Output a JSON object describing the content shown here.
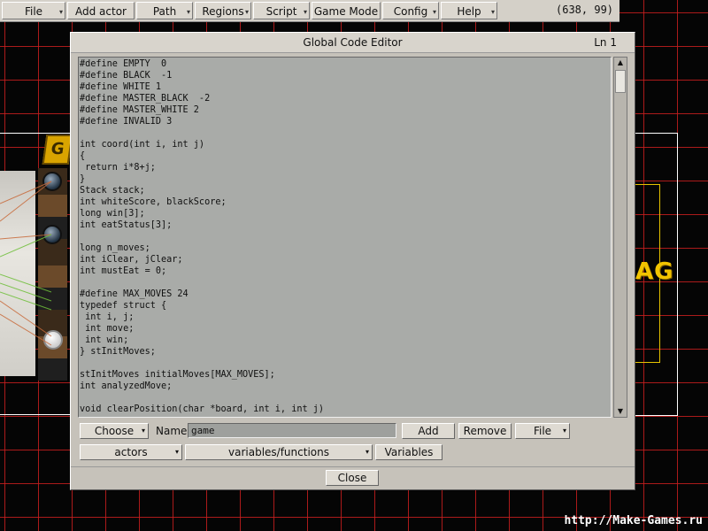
{
  "menu": {
    "items": [
      {
        "label": "File",
        "dropdown": true
      },
      {
        "label": "Add actor",
        "dropdown": false
      },
      {
        "label": "Path",
        "dropdown": true
      },
      {
        "label": "Regions",
        "dropdown": true
      },
      {
        "label": "Script",
        "dropdown": true
      },
      {
        "label": "Game Mode",
        "dropdown": false
      },
      {
        "label": "Config",
        "dropdown": true
      },
      {
        "label": "Help",
        "dropdown": true
      }
    ],
    "coords": "(638, 99)"
  },
  "editor": {
    "title": "Global Code Editor",
    "line_indicator": "Ln 1",
    "code_lines": [
      "#define EMPTY  0",
      "#define BLACK  -1",
      "#define WHITE 1",
      "#define MASTER_BLACK  -2",
      "#define MASTER_WHITE 2",
      "#define INVALID 3",
      "",
      "int coord(int i, int j)",
      "{",
      " return i*8+j;",
      "}",
      "Stack stack;",
      "int whiteScore, blackScore;",
      "long win[3];",
      "int eatStatus[3];",
      "",
      "long n_moves;",
      "int iClear, jClear;",
      "int mustEat = 0;",
      "",
      "#define MAX_MOVES 24",
      "typedef struct {",
      " int i, j;",
      " int move;",
      " int win;",
      "} stInitMoves;",
      "",
      "stInitMoves initialMoves[MAX_MOVES];",
      "int analyzedMove;",
      "",
      "void clearPosition(char *board, int i, int j)"
    ],
    "choose_label": "Choose",
    "name_label": "Name:",
    "name_value": "game",
    "add_label": "Add",
    "remove_label": "Remove",
    "file_label": "File",
    "actors_label": "actors",
    "varfunc_label": "variables/functions",
    "variables_label": "Variables",
    "close_label": "Close"
  },
  "scene": {
    "logo_letter": "G",
    "tag_text": "AG"
  },
  "watermark": "http://Make-Games.ru"
}
